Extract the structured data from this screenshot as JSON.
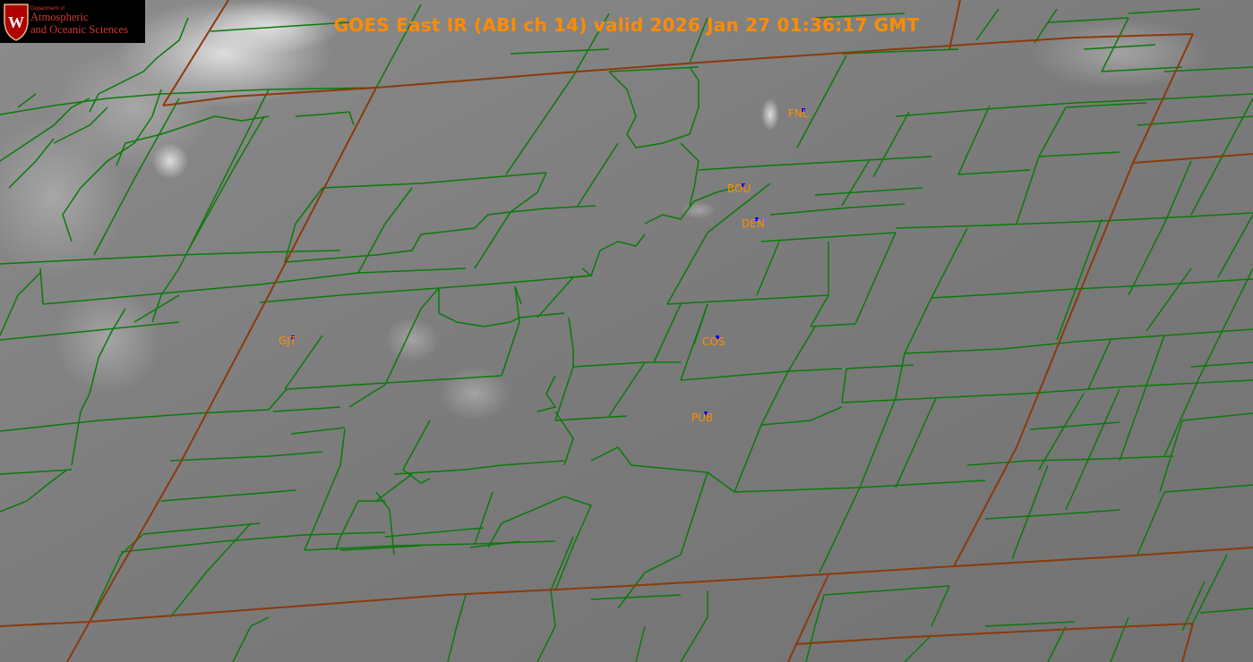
{
  "title": "GOES East IR (ABI ch 14) valid 2026 Jan 27 01:36:17 GMT",
  "logo": {
    "line1": "Department of",
    "line2": "Atmospheric",
    "line3": "and Oceanic Sciences",
    "color": "#d13a2e"
  },
  "stations": [
    {
      "id": "FNL"
    },
    {
      "id": "BOU"
    },
    {
      "id": "DEN"
    },
    {
      "id": "GJT"
    },
    {
      "id": "COS"
    },
    {
      "id": "PUB"
    }
  ],
  "colors": {
    "state_border": "#8b3a0a",
    "county_border": "#0a7a0a",
    "station_label": "#ff8c00",
    "station_marker": "#0000ff"
  }
}
